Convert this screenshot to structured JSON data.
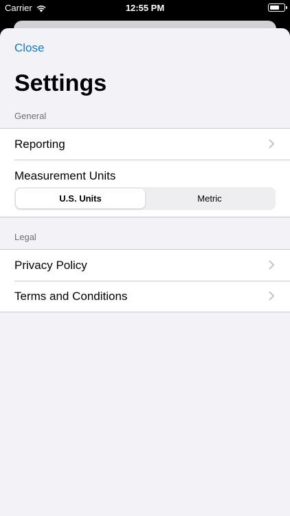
{
  "status_bar": {
    "carrier": "Carrier",
    "time": "12:55 PM"
  },
  "sheet": {
    "close_label": "Close",
    "title": "Settings"
  },
  "general": {
    "header": "General",
    "reporting_label": "Reporting",
    "measurement_label": "Measurement Units",
    "units_options": [
      "U.S. Units",
      "Metric"
    ],
    "units_selected": "U.S. Units"
  },
  "legal": {
    "header": "Legal",
    "items": [
      {
        "label": "Privacy Policy"
      },
      {
        "label": "Terms and Conditions"
      }
    ]
  },
  "colors": {
    "accent": "#1479c9",
    "background": "#f2f2f7",
    "separator": "#c8c7cc"
  }
}
